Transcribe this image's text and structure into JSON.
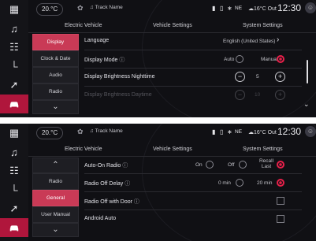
{
  "rail_icons": [
    "apps-icon",
    "music-icon",
    "radio-icon",
    "phone-icon",
    "navigation-icon",
    "car-icon"
  ],
  "status": {
    "temp": "20.°C",
    "track": "Track Name",
    "network": "NE",
    "outside_temp": "16°C",
    "outside_temp_suffix": "Out",
    "clock": "12:30"
  },
  "tabs": [
    "Electric Vehicle",
    "Vehicle Settings",
    "System Settings"
  ],
  "panel_top": {
    "submenu": [
      "Display",
      "Clock & Date",
      "Audio",
      "Radio"
    ],
    "active_submenu": "Display",
    "rows": {
      "language": {
        "label": "Language",
        "value": "English (United States)"
      },
      "display_mode": {
        "label": "Display Mode",
        "opt_auto": "Auto",
        "opt_manual": "Manual"
      },
      "brightness_night": {
        "label": "Display Brightness Nighttime",
        "value": "5"
      },
      "brightness_day": {
        "label": "Display Brightness Daytime",
        "value": "10"
      }
    }
  },
  "panel_bottom": {
    "submenu": [
      "Radio",
      "General",
      "User Manual"
    ],
    "active_submenu": "General",
    "rows": {
      "auto_on_radio": {
        "label": "Auto-On Radio",
        "opt_on": "On",
        "opt_off": "Off",
        "opt_recall": "Recall Last"
      },
      "radio_off_delay": {
        "label": "Radio Off Delay",
        "opt_0": "0 min",
        "opt_20": "20 min"
      },
      "radio_off_door": {
        "label": "Radio Off with Door"
      },
      "android_auto": {
        "label": "Android Auto"
      }
    }
  },
  "colors": {
    "accent": "#e8204a",
    "active_submenu": "#c93a56",
    "active_rail": "#b0163c"
  }
}
